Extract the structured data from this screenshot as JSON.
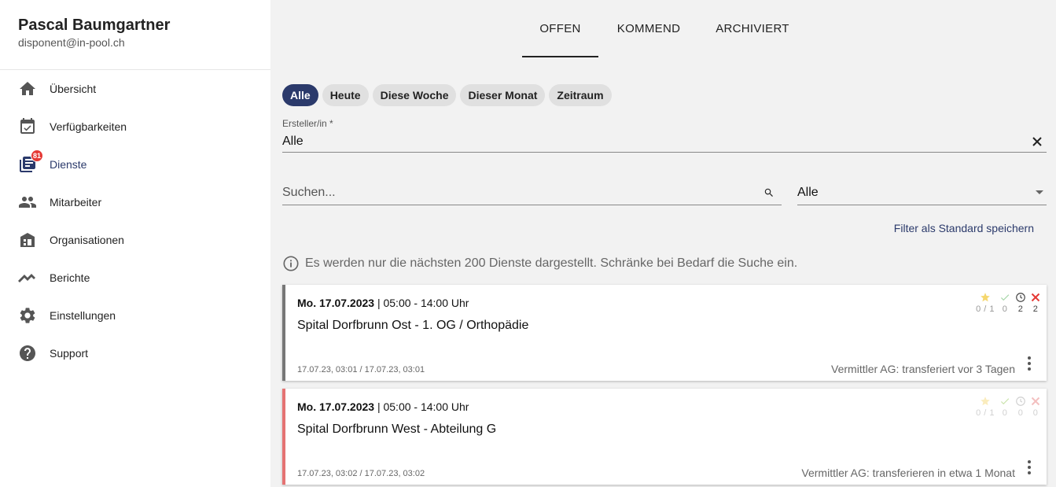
{
  "user": {
    "name": "Pascal Baumgartner",
    "email": "disponent@in-pool.ch"
  },
  "sidebar": {
    "items": [
      {
        "label": "Übersicht",
        "icon": "home-icon"
      },
      {
        "label": "Verfügbarkeiten",
        "icon": "calendar-check-icon"
      },
      {
        "label": "Dienste",
        "icon": "list-icon",
        "badge": "81",
        "active": true
      },
      {
        "label": "Mitarbeiter",
        "icon": "people-icon"
      },
      {
        "label": "Organisationen",
        "icon": "building-icon"
      },
      {
        "label": "Berichte",
        "icon": "trending-icon"
      },
      {
        "label": "Einstellungen",
        "icon": "gear-icon"
      },
      {
        "label": "Support",
        "icon": "help-icon"
      }
    ]
  },
  "tabs": [
    {
      "label": "OFFEN",
      "active": true
    },
    {
      "label": "KOMMEND"
    },
    {
      "label": "ARCHIVIERT"
    }
  ],
  "chips": [
    {
      "label": "Alle",
      "active": true
    },
    {
      "label": "Heute"
    },
    {
      "label": "Diese Woche"
    },
    {
      "label": "Dieser Monat"
    },
    {
      "label": "Zeitraum"
    }
  ],
  "creator": {
    "label": "Ersteller/in *",
    "value": "Alle"
  },
  "search": {
    "placeholder": "Suchen...",
    "value": ""
  },
  "select": {
    "value": "Alle"
  },
  "save_filter_label": "Filter als Standard speichern",
  "info_text": "Es werden nur die nächsten 200 Dienste dargestellt. Schränke bei Bedarf die Suche ein.",
  "colors": {
    "accent": "#2b3a6b",
    "badge": "#e53935",
    "card1_border": "#777777",
    "card2_border": "#e57373",
    "star": "#f5d76e",
    "check": "#8bc34a",
    "cancel": "#e53935"
  },
  "cards": [
    {
      "day": "Mo. 17.07.2023",
      "time": "| 05:00 - 14:00 Uhr",
      "title": "Spital Dorfbrunn Ost - 1. OG / Orthopädie",
      "created": "17.07.23, 03:01 / 17.07.23, 03:01",
      "agency": "Vermittler AG: transferiert vor 3 Tagen",
      "stats": {
        "star": "0 / 1",
        "check": "0",
        "clock": "2",
        "cancel": "2"
      }
    },
    {
      "day": "Mo. 17.07.2023",
      "time": "| 05:00 - 14:00 Uhr",
      "title": "Spital Dorfbrunn West - Abteilung G",
      "created": "17.07.23, 03:02 / 17.07.23, 03:02",
      "agency": "Vermittler AG: transferieren in etwa 1 Monat",
      "stats": {
        "star": "0 / 1",
        "check": "0",
        "clock": "0",
        "cancel": "0"
      }
    }
  ]
}
